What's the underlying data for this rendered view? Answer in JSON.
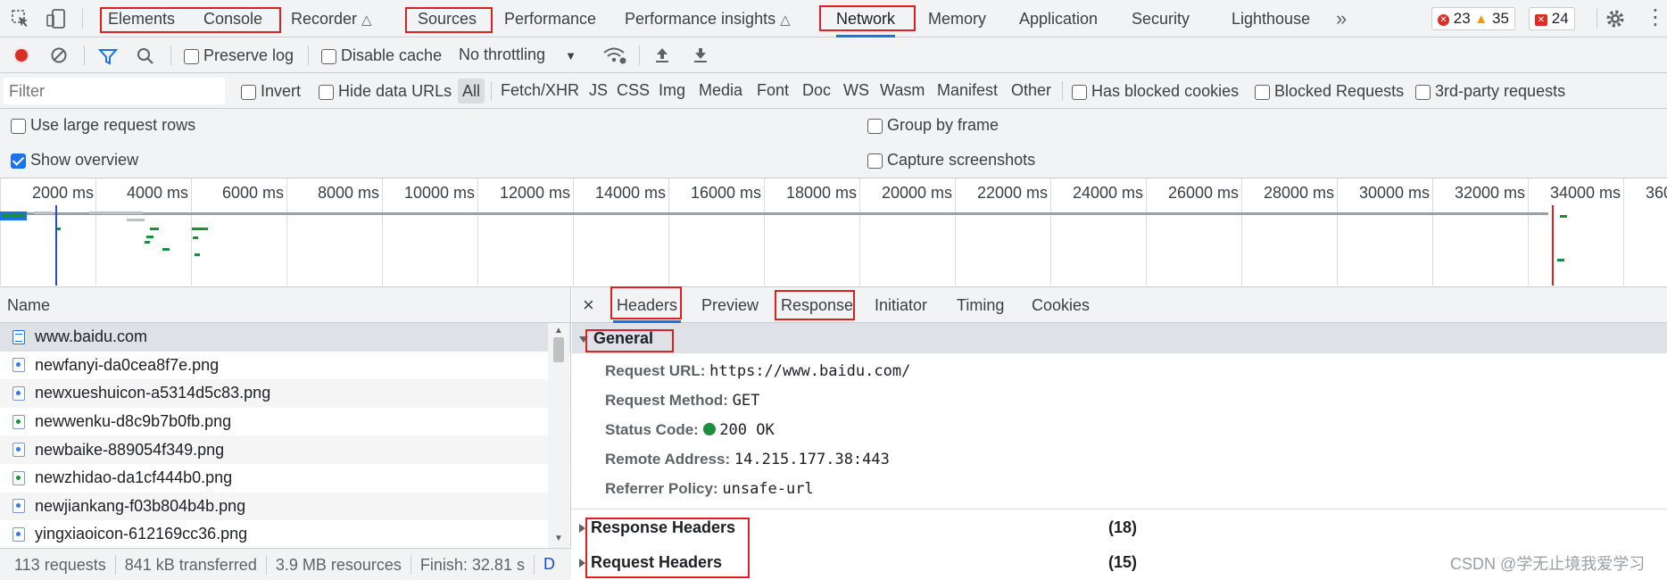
{
  "main_tabs": [
    {
      "label": "Elements"
    },
    {
      "label": "Console"
    },
    {
      "label": "Recorder"
    },
    {
      "label": "Sources"
    },
    {
      "label": "Performance"
    },
    {
      "label": "Performance insights"
    },
    {
      "label": "Network"
    },
    {
      "label": "Memory"
    },
    {
      "label": "Application"
    },
    {
      "label": "Security"
    },
    {
      "label": "Lighthouse"
    }
  ],
  "badges": {
    "errors": "23",
    "warnings": "35",
    "issues": "24"
  },
  "toolbar": {
    "preserve_log": "Preserve log",
    "disable_cache": "Disable cache",
    "throttling": "No throttling"
  },
  "filterbar": {
    "placeholder": "Filter",
    "invert": "Invert",
    "hide_data_urls": "Hide data URLs",
    "types": [
      "All",
      "Fetch/XHR",
      "JS",
      "CSS",
      "Img",
      "Media",
      "Font",
      "Doc",
      "WS",
      "Wasm",
      "Manifest",
      "Other"
    ],
    "has_blocked_cookies": "Has blocked cookies",
    "blocked_requests": "Blocked Requests",
    "third_party": "3rd-party requests"
  },
  "settings": {
    "large_rows": "Use large request rows",
    "group_by_frame": "Group by frame",
    "show_overview": "Show overview",
    "capture_screenshots": "Capture screenshots"
  },
  "timeline": {
    "ticks": [
      "2000 ms",
      "4000 ms",
      "6000 ms",
      "8000 ms",
      "10000 ms",
      "12000 ms",
      "14000 ms",
      "16000 ms",
      "18000 ms",
      "20000 ms",
      "22000 ms",
      "24000 ms",
      "26000 ms",
      "28000 ms",
      "30000 ms",
      "32000 ms",
      "34000 ms",
      "360"
    ]
  },
  "request_list": {
    "header": "Name",
    "rows": [
      {
        "name": "www.baidu.com"
      },
      {
        "name": "newfanyi-da0cea8f7e.png"
      },
      {
        "name": "newxueshuicon-a5314d5c83.png"
      },
      {
        "name": "newwenku-d8c9b7b0fb.png"
      },
      {
        "name": "newbaike-889054f349.png"
      },
      {
        "name": "newzhidao-da1cf444b0.png"
      },
      {
        "name": "newjiankang-f03b804b4b.png"
      },
      {
        "name": "yingxiaoicon-612169cc36.png"
      }
    ]
  },
  "status": {
    "requests": "113 requests",
    "transferred": "841 kB transferred",
    "resources": "3.9 MB resources",
    "finish": "Finish: 32.81 s",
    "dom": "D"
  },
  "detail_tabs": [
    {
      "label": "Headers"
    },
    {
      "label": "Preview"
    },
    {
      "label": "Response"
    },
    {
      "label": "Initiator"
    },
    {
      "label": "Timing"
    },
    {
      "label": "Cookies"
    }
  ],
  "general": {
    "title": "General",
    "request_url_k": "Request URL:",
    "request_url_v": "https://www.baidu.com/",
    "method_k": "Request Method:",
    "method_v": "GET",
    "status_k": "Status Code:",
    "status_v": "200 OK",
    "remote_k": "Remote Address:",
    "remote_v": "14.215.177.38:443",
    "referrer_k": "Referrer Policy:",
    "referrer_v": "unsafe-url"
  },
  "response_headers": {
    "title": "Response Headers",
    "count": "(18)"
  },
  "request_headers": {
    "title": "Request Headers",
    "count": "(15)"
  },
  "watermark": "CSDN @学无止境我爱学习"
}
